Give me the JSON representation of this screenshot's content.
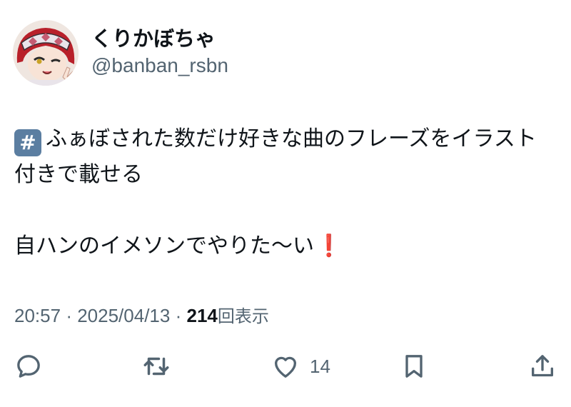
{
  "post": {
    "author": {
      "display_name": "くりかぼちゃ",
      "handle": "@banban_rsbn",
      "avatar_icon": "avatar-illustration"
    },
    "lines": {
      "hashtag_icon": "#",
      "line1": "ふぁぼされた数だけ好きな曲のフレーズをイラスト付きで載せる",
      "line2": "自ハンのイメソンでやりた〜い",
      "exclamation": "❗"
    },
    "meta": {
      "time": "20:57",
      "separator": "·",
      "date": "2025/04/13",
      "views_count": "214",
      "views_label": "回表示"
    },
    "actions": {
      "reply_icon": "reply-icon",
      "repost_icon": "repost-icon",
      "like_icon": "heart-icon",
      "like_count": "14",
      "bookmark_icon": "bookmark-icon",
      "share_icon": "share-icon"
    }
  },
  "colors": {
    "text": "#0f1419",
    "secondary": "#536471",
    "hashtag_bg": "#5b7ea1",
    "exclamation": "#d8262f"
  }
}
